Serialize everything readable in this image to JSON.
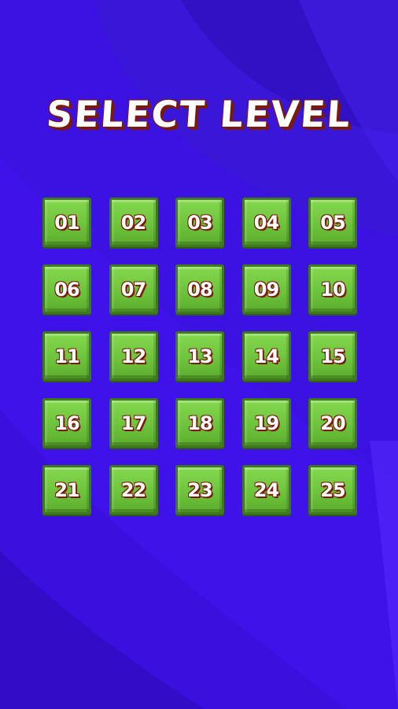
{
  "screen": {
    "title": "SELECT LEVEL",
    "background_color": "#3d10e6",
    "button_color": "#6bc23a",
    "text_outline_color": "#7a1a0a"
  },
  "levels": [
    {
      "label": "01"
    },
    {
      "label": "02"
    },
    {
      "label": "03"
    },
    {
      "label": "04"
    },
    {
      "label": "05"
    },
    {
      "label": "06"
    },
    {
      "label": "07"
    },
    {
      "label": "08"
    },
    {
      "label": "09"
    },
    {
      "label": "10"
    },
    {
      "label": "11"
    },
    {
      "label": "12"
    },
    {
      "label": "13"
    },
    {
      "label": "14"
    },
    {
      "label": "15"
    },
    {
      "label": "16"
    },
    {
      "label": "17"
    },
    {
      "label": "18"
    },
    {
      "label": "19"
    },
    {
      "label": "20"
    },
    {
      "label": "21"
    },
    {
      "label": "22"
    },
    {
      "label": "23"
    },
    {
      "label": "24"
    },
    {
      "label": "25"
    }
  ]
}
